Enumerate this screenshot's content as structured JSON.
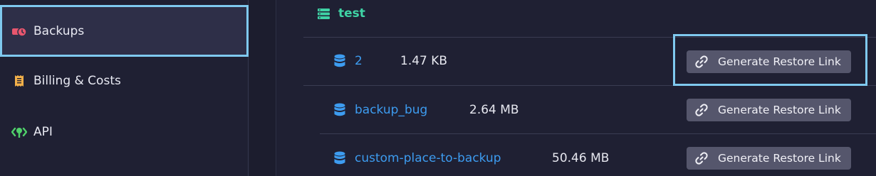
{
  "sidebar": {
    "items": [
      {
        "label": "Backups",
        "icon": "backup-clock-icon",
        "active": true
      },
      {
        "label": "Billing & Costs",
        "icon": "receipt-icon",
        "active": false
      },
      {
        "label": "API",
        "icon": "api-icon",
        "active": false
      }
    ]
  },
  "main": {
    "section_title": "test",
    "rows": [
      {
        "name": "2",
        "size": "1.47 KB",
        "action": "Generate Restore Link"
      },
      {
        "name": "backup_bug",
        "size": "2.64 MB",
        "action": "Generate Restore Link"
      },
      {
        "name": "custom-place-to-backup",
        "size": "50.46 MB",
        "action": "Generate Restore Link"
      }
    ]
  },
  "colors": {
    "background": "#1f2033",
    "accent_teal": "#3fd3a5",
    "link_blue": "#3d9cf0",
    "button_bg": "#55566c",
    "focus_outline": "#7fc9ef"
  }
}
